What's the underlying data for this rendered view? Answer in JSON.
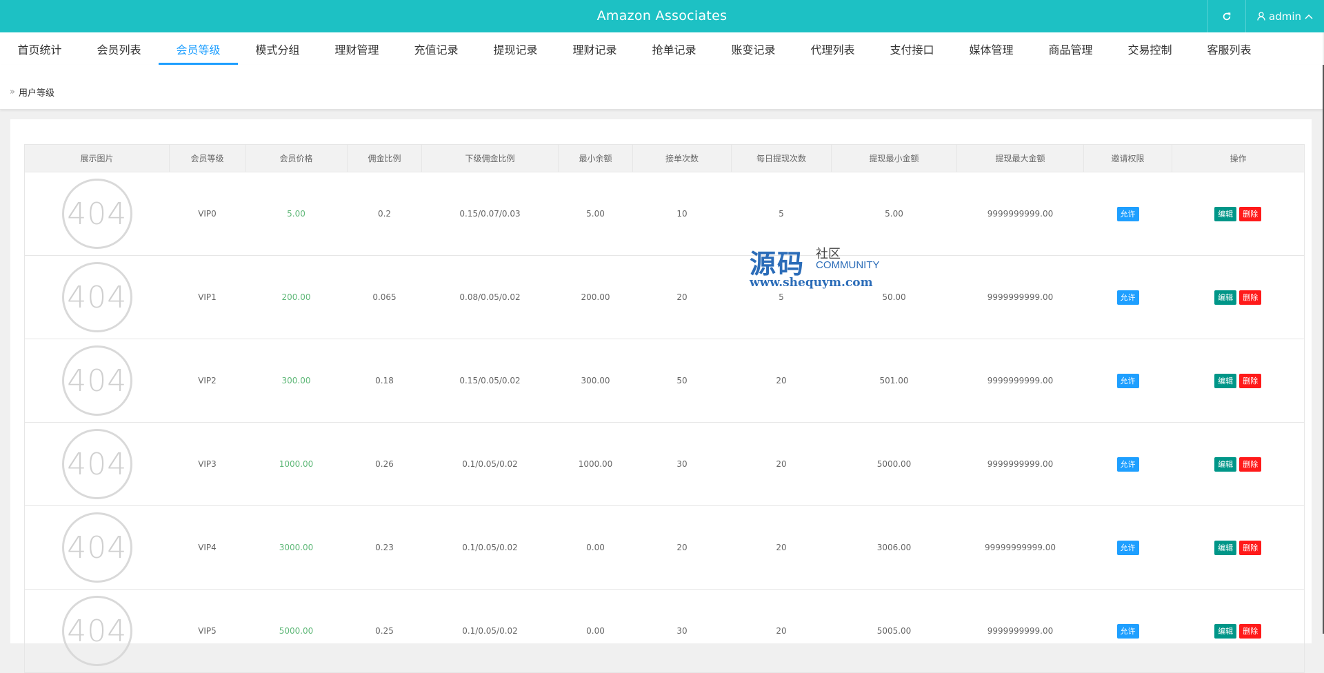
{
  "app": {
    "title": "Amazon Associates",
    "user": "admin"
  },
  "nav": [
    {
      "label": "首页统计",
      "active": false
    },
    {
      "label": "会员列表",
      "active": false
    },
    {
      "label": "会员等级",
      "active": true
    },
    {
      "label": "模式分组",
      "active": false
    },
    {
      "label": "理财管理",
      "active": false
    },
    {
      "label": "充值记录",
      "active": false
    },
    {
      "label": "提现记录",
      "active": false
    },
    {
      "label": "理财记录",
      "active": false
    },
    {
      "label": "抢单记录",
      "active": false
    },
    {
      "label": "账变记录",
      "active": false
    },
    {
      "label": "代理列表",
      "active": false
    },
    {
      "label": "支付接口",
      "active": false
    },
    {
      "label": "媒体管理",
      "active": false
    },
    {
      "label": "商品管理",
      "active": false
    },
    {
      "label": "交易控制",
      "active": false
    },
    {
      "label": "客服列表",
      "active": false
    }
  ],
  "breadcrumb": {
    "sep": "»",
    "current": "用户等级"
  },
  "table": {
    "headers": [
      "展示图片",
      "会员等级",
      "会员价格",
      "佣金比例",
      "下级佣金比例",
      "最小余额",
      "接单次数",
      "每日提现次数",
      "提现最小金额",
      "提现最大金额",
      "邀请权限",
      "操作"
    ],
    "image_placeholder": "404",
    "allow_label": "允许",
    "edit_label": "编辑",
    "delete_label": "删除",
    "rows": [
      {
        "level": "VIP0",
        "price": "5.00",
        "commission": "0.2",
        "sub_commission": "0.15/0.07/0.03",
        "min_balance": "5.00",
        "orders": "10",
        "daily_withdraw": "5",
        "withdraw_min": "5.00",
        "withdraw_max": "9999999999.00"
      },
      {
        "level": "VIP1",
        "price": "200.00",
        "commission": "0.065",
        "sub_commission": "0.08/0.05/0.02",
        "min_balance": "200.00",
        "orders": "20",
        "daily_withdraw": "5",
        "withdraw_min": "50.00",
        "withdraw_max": "9999999999.00"
      },
      {
        "level": "VIP2",
        "price": "300.00",
        "commission": "0.18",
        "sub_commission": "0.15/0.05/0.02",
        "min_balance": "300.00",
        "orders": "50",
        "daily_withdraw": "20",
        "withdraw_min": "501.00",
        "withdraw_max": "9999999999.00"
      },
      {
        "level": "VIP3",
        "price": "1000.00",
        "commission": "0.26",
        "sub_commission": "0.1/0.05/0.02",
        "min_balance": "1000.00",
        "orders": "30",
        "daily_withdraw": "20",
        "withdraw_min": "5000.00",
        "withdraw_max": "9999999999.00"
      },
      {
        "level": "VIP4",
        "price": "3000.00",
        "commission": "0.23",
        "sub_commission": "0.1/0.05/0.02",
        "min_balance": "0.00",
        "orders": "20",
        "daily_withdraw": "20",
        "withdraw_min": "3006.00",
        "withdraw_max": "99999999999.00"
      },
      {
        "level": "VIP5",
        "price": "5000.00",
        "commission": "0.25",
        "sub_commission": "0.1/0.05/0.02",
        "min_balance": "0.00",
        "orders": "30",
        "daily_withdraw": "20",
        "withdraw_min": "5005.00",
        "withdraw_max": "9999999999.00"
      }
    ]
  },
  "watermark": {
    "big": "源码",
    "small": "社区",
    "community": "COMMUNITY",
    "url": "www.shequym.com"
  },
  "colors": {
    "topbar": "#1dc1c4",
    "accent": "#1e9fff",
    "price": "#5fb878",
    "edit": "#009688",
    "delete": "#ff1a1a"
  }
}
